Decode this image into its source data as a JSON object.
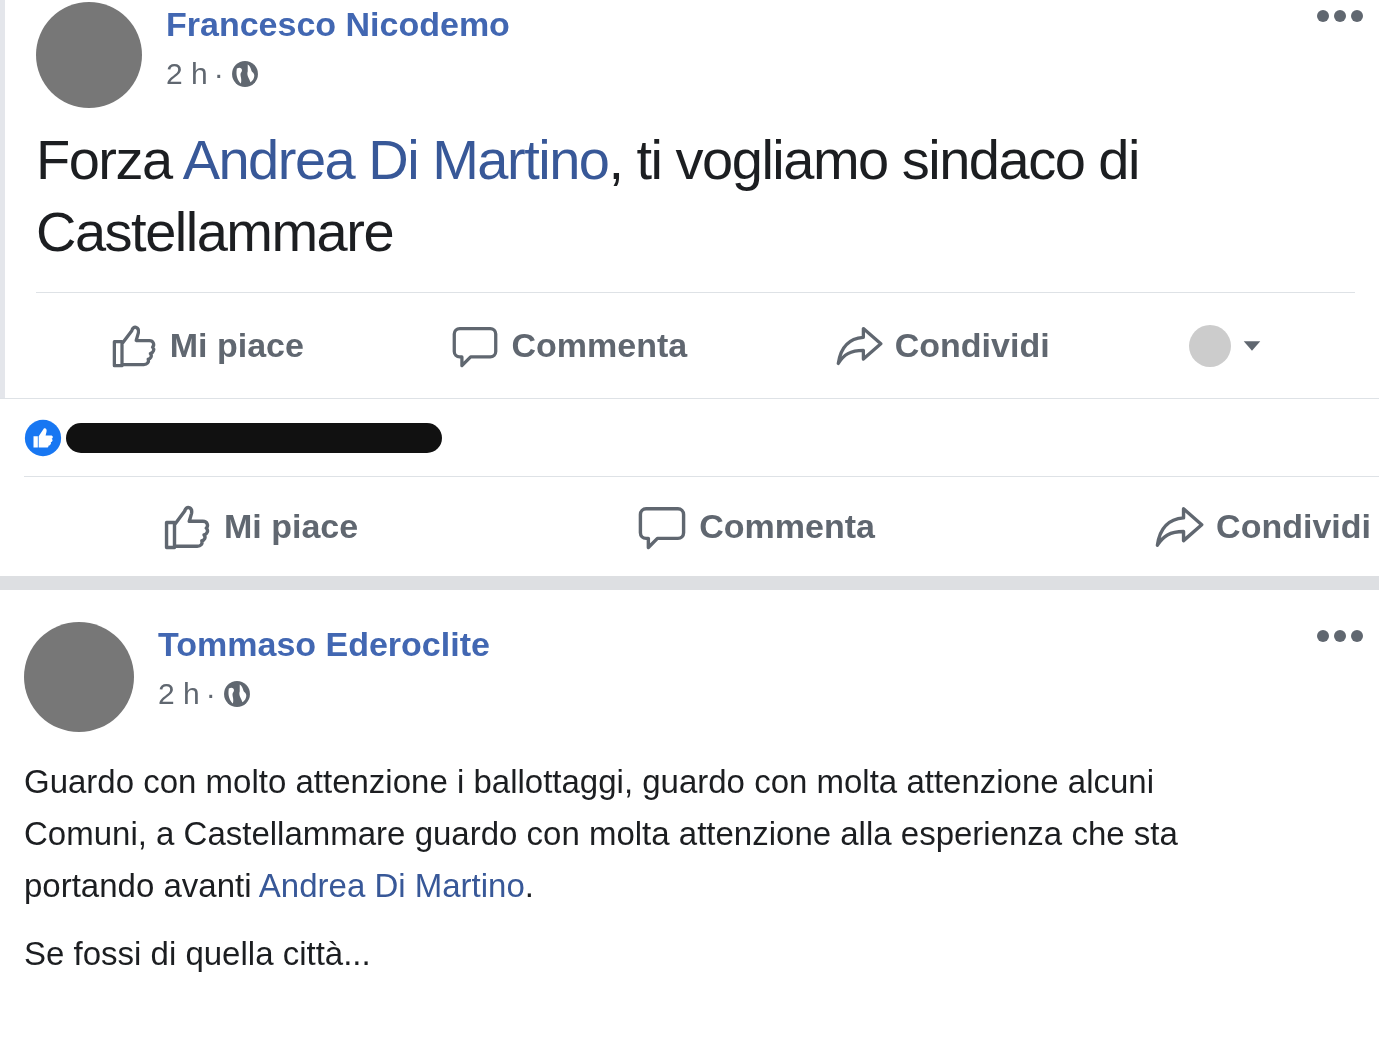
{
  "post": {
    "author": "Francesco Nicodemo",
    "time": "2 h",
    "separator": "·",
    "text": "Forza **Andrea Di Martino**, ti vogliamo sindaco di Castellammare",
    "actions": [
      {
        "kind": "like",
        "label": "Mi piace"
      },
      {
        "kind": "comment",
        "label": "Commenta"
      },
      {
        "kind": "share",
        "label": "Condividi"
      }
    ]
  },
  "shared_reaction": {
    "redacted": true
  },
  "reaction_actions": [
    {
      "kind": "like",
      "label": "Mi piace"
    },
    {
      "kind": "comment",
      "label": "Commenta"
    },
    {
      "kind": "share",
      "label": "Condividi"
    }
  ],
  "second_post": {
    "author": "Tommaso Ederoclite",
    "time": "2 h",
    "separator": "·",
    "paragraphs": [
      "Guardo con molto attenzione i ballottaggi, guardo con molta attenzione alcuni Comuni, a Castellammare guardo con molta attenzione alla esperienza che sta portando avanti **Andrea Di Martino**.",
      "Se fossi di quella città..."
    ]
  }
}
